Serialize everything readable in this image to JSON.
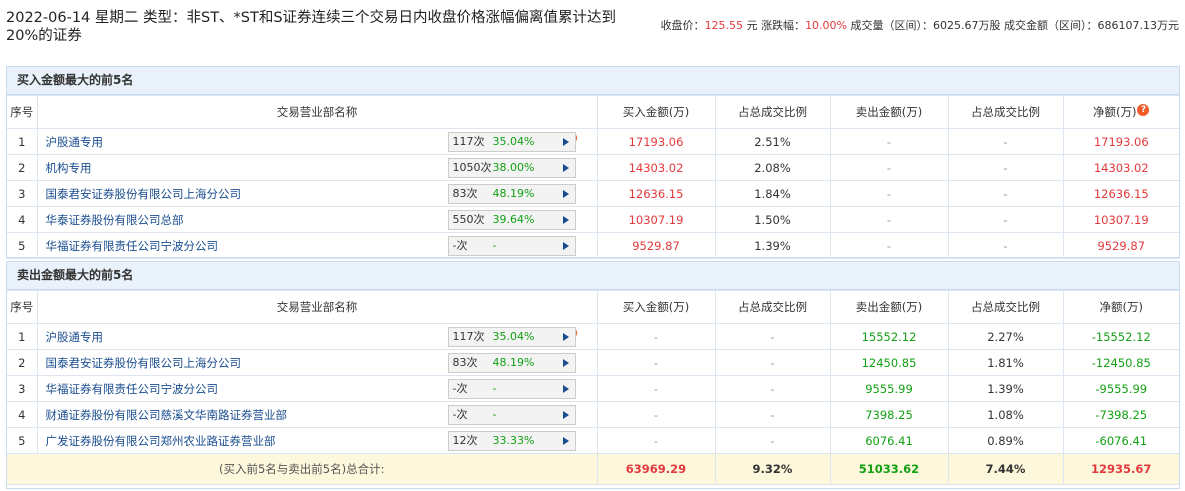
{
  "header": {
    "title": "2022-06-14 星期二 类型：非ST、*ST和S证券连续三个交易日内收盘价格涨幅偏离值累计达到20%的证券",
    "close_label": "收盘价：",
    "close_value": "125.55",
    "close_unit": "元",
    "change_label": "涨跌幅：",
    "change_value": "10.00%",
    "volume_text": "成交量（区间）：6025.67万股",
    "amount_text": "成交金额（区间）：686107.13万元"
  },
  "columns": {
    "seq": "序号",
    "name": "交易营业部名称",
    "buy": "买入金额(万)",
    "buy_pct": "占总成交比例",
    "sell": "卖出金额(万)",
    "sell_pct": "占总成交比例",
    "net": "净额(万)"
  },
  "buy_section": {
    "title": "买入金额最大的前5名",
    "rows": [
      {
        "seq": "1",
        "name": "沪股通专用",
        "count": "117次",
        "pct": "35.04%",
        "help": true,
        "buy": "17193.06",
        "buy_pct": "2.51%",
        "sell": "-",
        "sell_pct": "-",
        "net": "17193.06"
      },
      {
        "seq": "2",
        "name": "机构专用",
        "count": "1050次",
        "pct": "38.00%",
        "help": false,
        "buy": "14303.02",
        "buy_pct": "2.08%",
        "sell": "-",
        "sell_pct": "-",
        "net": "14303.02"
      },
      {
        "seq": "3",
        "name": "国泰君安证券股份有限公司上海分公司",
        "count": "83次",
        "pct": "48.19%",
        "help": false,
        "buy": "12636.15",
        "buy_pct": "1.84%",
        "sell": "-",
        "sell_pct": "-",
        "net": "12636.15"
      },
      {
        "seq": "4",
        "name": "华泰证券股份有限公司总部",
        "count": "550次",
        "pct": "39.64%",
        "help": false,
        "buy": "10307.19",
        "buy_pct": "1.50%",
        "sell": "-",
        "sell_pct": "-",
        "net": "10307.19"
      },
      {
        "seq": "5",
        "name": "华福证券有限责任公司宁波分公司",
        "count": "-次",
        "pct": "-",
        "help": false,
        "buy": "9529.87",
        "buy_pct": "1.39%",
        "sell": "-",
        "sell_pct": "-",
        "net": "9529.87"
      }
    ]
  },
  "sell_section": {
    "title": "卖出金额最大的前5名",
    "rows": [
      {
        "seq": "1",
        "name": "沪股通专用",
        "count": "117次",
        "pct": "35.04%",
        "help": true,
        "buy": "-",
        "buy_pct": "-",
        "sell": "15552.12",
        "sell_pct": "2.27%",
        "net": "-15552.12"
      },
      {
        "seq": "2",
        "name": "国泰君安证券股份有限公司上海分公司",
        "count": "83次",
        "pct": "48.19%",
        "help": false,
        "buy": "-",
        "buy_pct": "-",
        "sell": "12450.85",
        "sell_pct": "1.81%",
        "net": "-12450.85"
      },
      {
        "seq": "3",
        "name": "华福证券有限责任公司宁波分公司",
        "count": "-次",
        "pct": "-",
        "help": false,
        "buy": "-",
        "buy_pct": "-",
        "sell": "9555.99",
        "sell_pct": "1.39%",
        "net": "-9555.99"
      },
      {
        "seq": "4",
        "name": "财通证券股份有限公司慈溪文华南路证券营业部",
        "count": "-次",
        "pct": "-",
        "help": false,
        "buy": "-",
        "buy_pct": "-",
        "sell": "7398.25",
        "sell_pct": "1.08%",
        "net": "-7398.25"
      },
      {
        "seq": "5",
        "name": "广发证券股份有限公司郑州农业路证券营业部",
        "count": "12次",
        "pct": "33.33%",
        "help": false,
        "buy": "-",
        "buy_pct": "-",
        "sell": "6076.41",
        "sell_pct": "0.89%",
        "net": "-6076.41"
      }
    ],
    "total": {
      "label": "(买入前5名与卖出前5名)总合计:",
      "buy": "63969.29",
      "buy_pct": "9.32%",
      "sell": "51033.62",
      "sell_pct": "7.44%",
      "net": "12935.67"
    }
  },
  "colors": {
    "up": "#e4393c",
    "down": "#13a113",
    "link": "#1a4d8f",
    "section_bg": "#e9f1fa",
    "total_bg": "#fdf7dc"
  },
  "icons": {
    "help": "question-mark-icon",
    "detail": "triangle-right-icon"
  }
}
